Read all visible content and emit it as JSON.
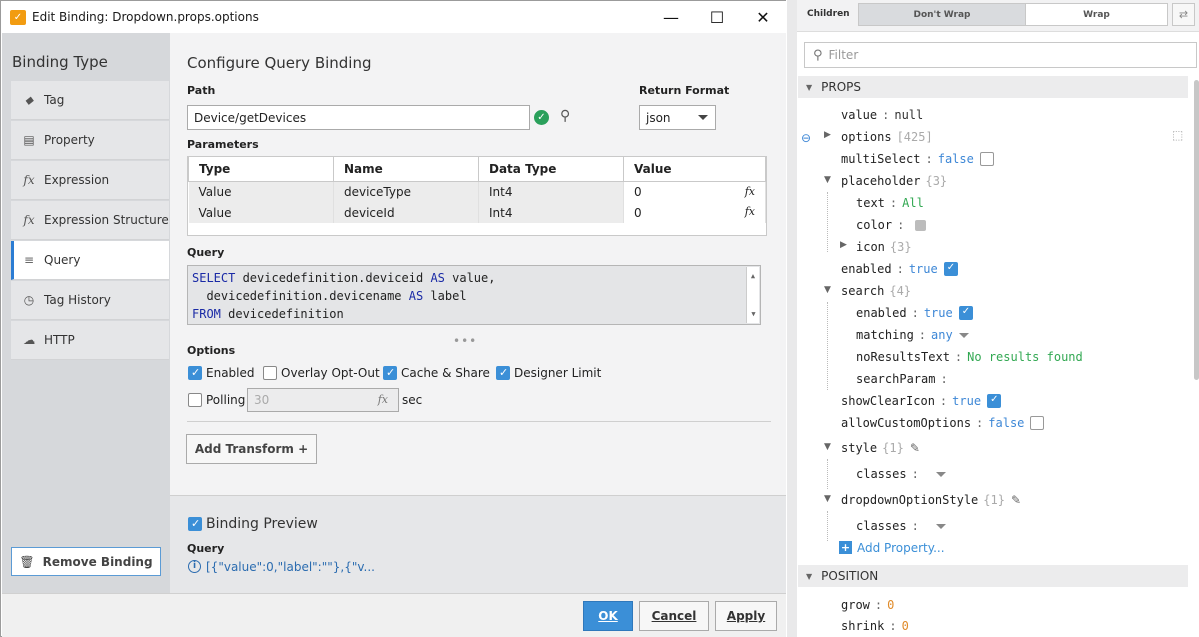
{
  "dialog": {
    "title": "Edit Binding: Dropdown.props.options",
    "app_icon": "ignition-icon",
    "window_controls": {
      "minimize": "—",
      "maximize": "☐",
      "close": "✕"
    }
  },
  "binding_type": {
    "heading": "Binding Type",
    "items": [
      {
        "label": "Tag",
        "icon": "tag-icon",
        "glyph": "⬥"
      },
      {
        "label": "Property",
        "icon": "property-icon",
        "glyph": "▤"
      },
      {
        "label": "Expression",
        "icon": "fx-icon",
        "glyph": "fx"
      },
      {
        "label": "Expression Structure",
        "icon": "fx-icon",
        "glyph": "fx"
      },
      {
        "label": "Query",
        "icon": "database-icon",
        "glyph": "≡",
        "selected": true
      },
      {
        "label": "Tag History",
        "icon": "clock-icon",
        "glyph": "◷"
      },
      {
        "label": "HTTP",
        "icon": "cloud-icon",
        "glyph": "☁"
      }
    ],
    "remove_label": "Remove Binding"
  },
  "config": {
    "title": "Configure Query Binding",
    "path_label": "Path",
    "path_value": "Device/getDevices",
    "return_format_label": "Return Format",
    "return_format_value": "json",
    "parameters_label": "Parameters",
    "param_headers": [
      "Type",
      "Name",
      "Data Type",
      "Value"
    ],
    "params": [
      {
        "type": "Value",
        "name": "deviceType",
        "data_type": "Int4",
        "value": "0"
      },
      {
        "type": "Value",
        "name": "deviceId",
        "data_type": "Int4",
        "value": "0"
      }
    ],
    "query_label": "Query",
    "query_lines": [
      {
        "kw1": "SELECT",
        "mid": " devicedefinition.deviceid ",
        "kw2": "AS",
        "end": " value,"
      },
      {
        "kw1": "",
        "mid": "  devicedefinition.devicename ",
        "kw2": "AS",
        "end": " label"
      },
      {
        "kw1": "FROM",
        "mid": " devicedefinition",
        "kw2": "",
        "end": ""
      }
    ],
    "options_label": "Options",
    "options": [
      {
        "label": "Enabled",
        "checked": true
      },
      {
        "label": "Overlay Opt-Out",
        "checked": false
      },
      {
        "label": "Cache & Share",
        "checked": true
      },
      {
        "label": "Designer Limit",
        "checked": true
      }
    ],
    "polling_label": "Polling",
    "polling_value": "30",
    "polling_unit": "sec",
    "add_transform_label": "Add Transform +"
  },
  "preview": {
    "title": "Binding Preview",
    "checked": true,
    "query_label": "Query",
    "query_result": "[{\"value\":0,\"label\":\"\"},{\"v..."
  },
  "footer": {
    "ok": "OK",
    "cancel": "Cancel",
    "apply": "Apply"
  },
  "props_panel": {
    "children_label": "Children",
    "wrap_options": [
      "Don't Wrap",
      "Wrap"
    ],
    "filter_placeholder": "Filter",
    "sections": [
      "PROPS",
      "POSITION"
    ],
    "add_property": "Add Property...",
    "props": {
      "value": "null",
      "options_count": "[425]",
      "multiSelect": "false",
      "placeholder_count": "{3}",
      "text": "All",
      "icon_count": "{3}",
      "enabled": "true",
      "search_count": "{4}",
      "search_enabled": "true",
      "matching": "any",
      "noResultsText": "No results found",
      "showClearIcon": "true",
      "allowCustomOptions": "false",
      "style_count": "{1}",
      "dropdownOptionStyle_count": "{1}",
      "grow": "0",
      "shrink": "0"
    }
  },
  "colors": {
    "accent": "#3b8fd7",
    "bool": "#3d87d6",
    "string": "#32a852",
    "number": "#e08b2a"
  }
}
